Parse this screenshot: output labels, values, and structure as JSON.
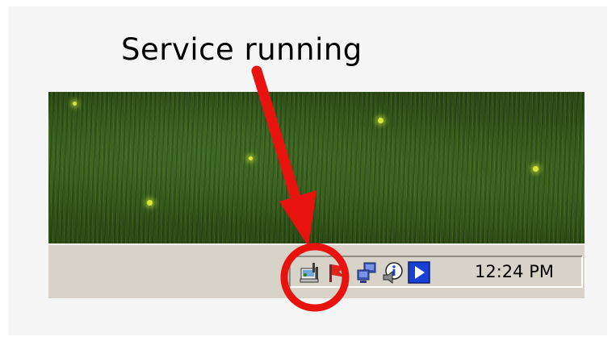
{
  "annotation": {
    "label": "Service running",
    "arrow_color": "#e8130e",
    "circle_color": "#e8130e"
  },
  "desktop": {
    "wallpaper": "grass-with-fireflies"
  },
  "taskbar": {
    "tray": {
      "icons": [
        {
          "name": "service-monitor-icon",
          "status": "running"
        },
        {
          "name": "red-flag-icon"
        },
        {
          "name": "network-connections-icon"
        },
        {
          "name": "info-speaker-icon"
        },
        {
          "name": "media-play-icon"
        }
      ],
      "clock": "12:24 PM"
    }
  }
}
